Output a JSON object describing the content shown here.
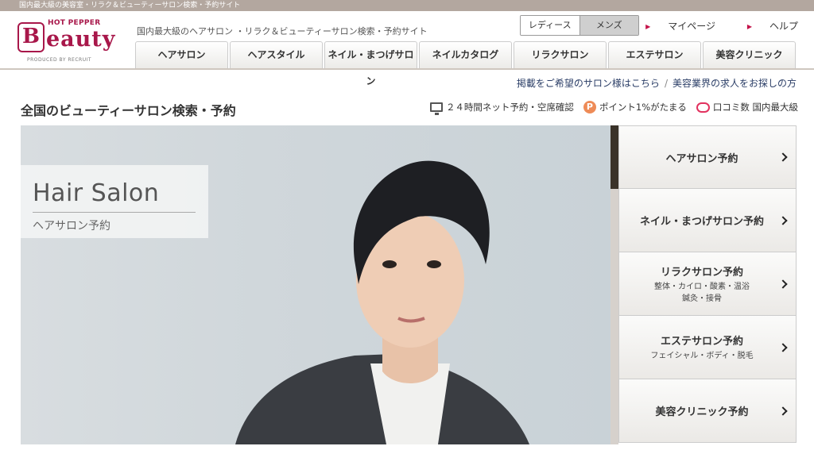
{
  "topbar": {
    "text": "国内最大級の美容室・リラク＆ビューティーサロン検索・予約サイト"
  },
  "logo": {
    "brand_top": "HOT PEPPER",
    "brand_b": "B",
    "brand_rest": "eauty",
    "produced_by": "PRODUCED BY RECRUIT"
  },
  "header": {
    "tagline": "国内最大級のヘアサロン ・リラク＆ビューティーサロン検索・予約サイト",
    "gender": {
      "ladies": "レディース",
      "mens": "メンズ"
    },
    "links": {
      "mypage": "マイページ",
      "help": "ヘルプ"
    }
  },
  "nav": {
    "tabs": [
      {
        "label": "ヘアサロン"
      },
      {
        "label": "ヘアスタイル"
      },
      {
        "label": "ネイル・まつげサロン"
      },
      {
        "label": "ネイルカタログ"
      },
      {
        "label": "リラクサロン"
      },
      {
        "label": "エステサロン"
      },
      {
        "label": "美容クリニック"
      }
    ]
  },
  "sublinks": {
    "listing": "掲載をご希望のサロン様はこちら",
    "separator": "/",
    "jobs": "美容業界の求人をお探しの方"
  },
  "page": {
    "title": "全国のビューティーサロン検索・予約"
  },
  "features": [
    {
      "icon": "monitor-icon",
      "text": "２４時間ネット予約・空席確認"
    },
    {
      "icon": "point-icon",
      "icon_text": "P",
      "text": "ポイント1%がたまる"
    },
    {
      "icon": "speech-bubble-icon",
      "text": "口コミ数 国内最大級"
    }
  ],
  "hero": {
    "title": "Hair Salon",
    "subtitle": "ヘアサロン予約"
  },
  "categories": [
    {
      "label": "ヘアサロン予約",
      "desc": ""
    },
    {
      "label": "ネイル・まつげサロン予約",
      "desc": ""
    },
    {
      "label": "リラクサロン予約",
      "desc": "整体・カイロ・酸素・温浴",
      "desc2": "鍼灸・接骨"
    },
    {
      "label": "エステサロン予約",
      "desc": "フェイシャル・ボディ・脱毛"
    },
    {
      "label": "美容クリニック予約",
      "desc": ""
    }
  ],
  "colors": {
    "brand": "#a8174a",
    "accent": "#c4134a",
    "point": "#ee8b57"
  }
}
